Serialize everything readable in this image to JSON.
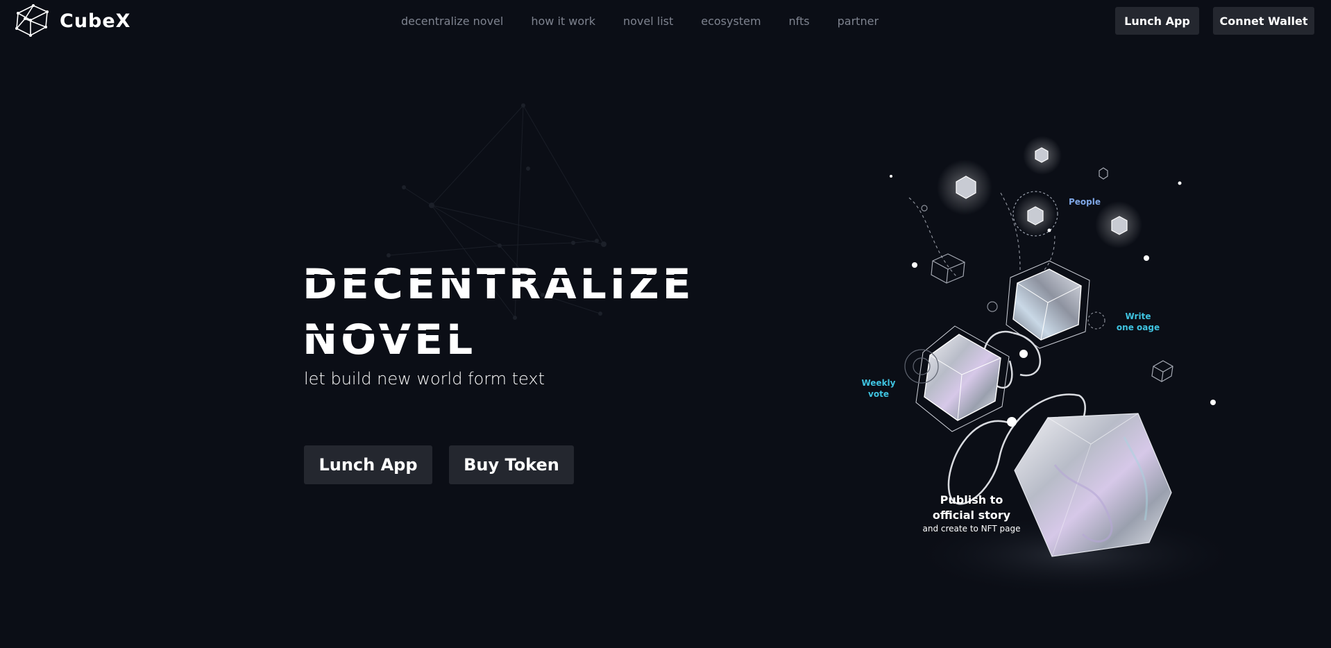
{
  "brand": {
    "name": "CubeX",
    "logo_icon": "cube-wireframe-icon"
  },
  "nav": {
    "links": [
      "decentralize novel",
      "how it work",
      "novel list",
      "ecosystem",
      "nfts",
      "partner"
    ],
    "launch_label": "Lunch App",
    "wallet_label": "Connet Wallet"
  },
  "hero": {
    "title_line1": "DECENTRALIZE",
    "title_line2": "NOVEL",
    "subtitle": "let build new world form text",
    "launch_label": "Lunch App",
    "buy_label": "Buy Token"
  },
  "illustration": {
    "people": "People",
    "write_line1": "Write",
    "write_line2": "one oage",
    "vote_line1": "Weekly",
    "vote_line2": "vote",
    "publish_line1": "Publish to",
    "publish_line2": "official story",
    "publish_line3": "and create to NFT page"
  },
  "colors": {
    "background": "#0b0e16",
    "button": "#24272f",
    "accent_cyan": "#3fc3e0",
    "accent_blue": "#7fa7e6"
  }
}
